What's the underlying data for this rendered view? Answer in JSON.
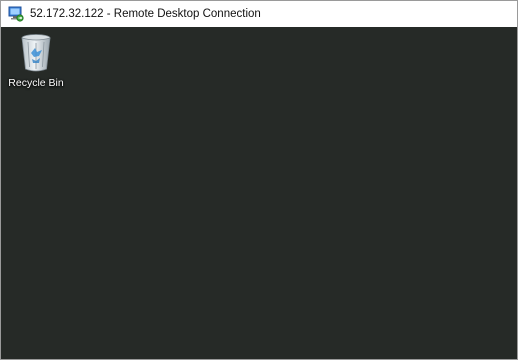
{
  "window": {
    "title": "52.172.32.122 - Remote Desktop Connection",
    "app_icon": "remote-desktop-icon"
  },
  "desktop": {
    "background_color": "#262a27",
    "icons": [
      {
        "label": "Recycle Bin",
        "icon": "recycle-bin-icon"
      }
    ]
  }
}
